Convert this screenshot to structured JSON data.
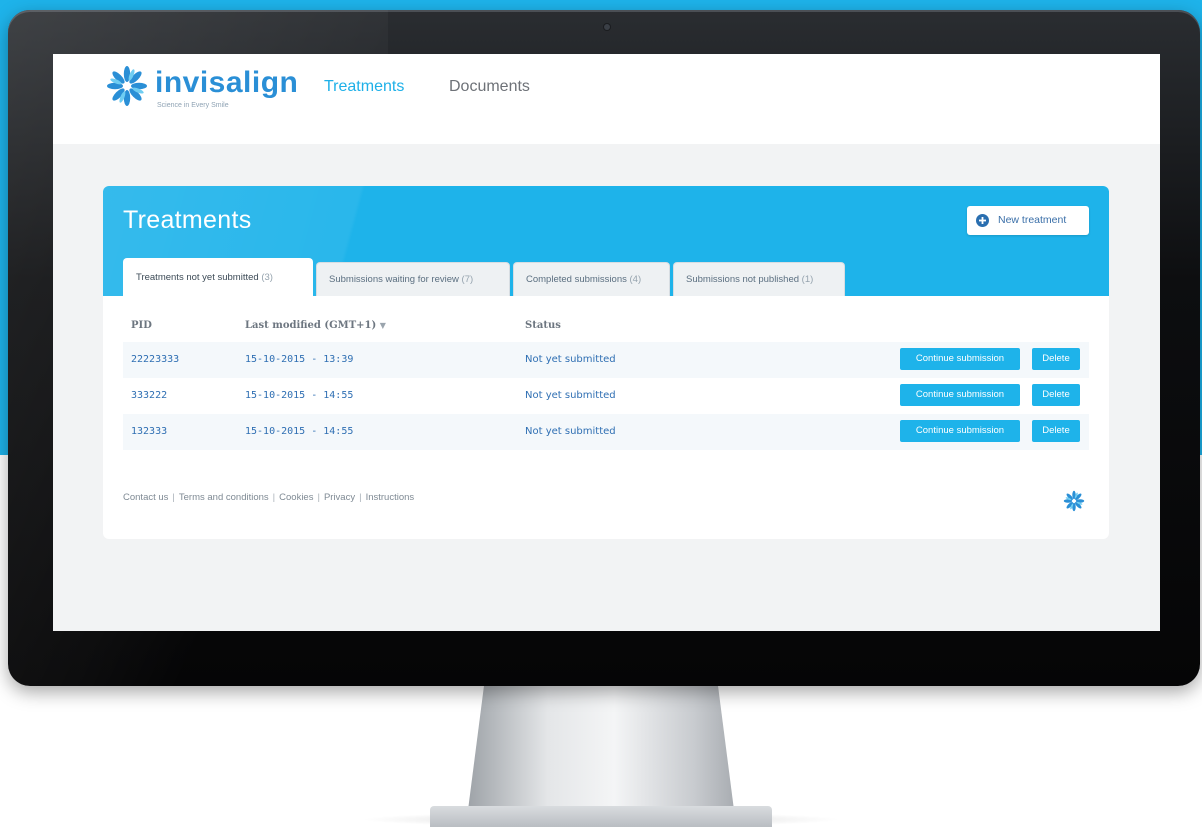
{
  "colors": {
    "brand_blue": "#1eb3ea",
    "logo_blue": "#2a8fd6",
    "link_blue": "#2f6fb3",
    "nav_inactive": "#6e7278"
  },
  "icons": {
    "logo": "invisalign-star-icon",
    "new_treatment": "plus-circle-icon",
    "sort": "caret-down-icon",
    "footer": "invisalign-star-icon"
  },
  "brand": {
    "name": "invisalign",
    "tagline": "Science in Every Smile"
  },
  "nav": {
    "items": [
      {
        "label": "Treatments",
        "active": true
      },
      {
        "label": "Documents",
        "active": false
      }
    ]
  },
  "panel": {
    "title": "Treatments",
    "new_button": "New treatment",
    "tabs": [
      {
        "label": "Treatments not yet submitted",
        "count": "(3)",
        "active": true
      },
      {
        "label": "Submissions waiting for review",
        "count": "(7)",
        "active": false
      },
      {
        "label": "Completed submissions",
        "count": "(4)",
        "active": false
      },
      {
        "label": "Submissions not published",
        "count": "(1)",
        "active": false
      }
    ]
  },
  "table": {
    "headers": {
      "pid": "PID",
      "modified": "Last modified (GMT+1)",
      "sort_caret": "▼",
      "status": "Status"
    },
    "rows": [
      {
        "pid": "22223333",
        "modified": "15-10-2015 - 13:39",
        "status": "Not yet submitted",
        "continue": "Continue submission",
        "delete": "Delete"
      },
      {
        "pid": "333222",
        "modified": "15-10-2015 - 14:55",
        "status": "Not yet submitted",
        "continue": "Continue submission",
        "delete": "Delete"
      },
      {
        "pid": "132333",
        "modified": "15-10-2015 - 14:55",
        "status": "Not yet submitted",
        "continue": "Continue submission",
        "delete": "Delete"
      }
    ]
  },
  "footer": {
    "links": [
      "Contact us",
      "Terms and conditions",
      "Cookies",
      "Privacy",
      "Instructions"
    ],
    "separator": "|"
  }
}
